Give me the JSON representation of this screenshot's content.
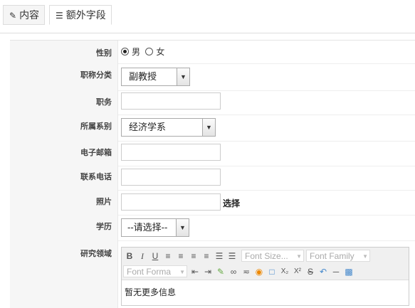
{
  "tabs": [
    {
      "label": "内容",
      "icon": "edit-icon"
    },
    {
      "label": "额外字段",
      "icon": "fields-icon"
    }
  ],
  "fields": {
    "gender": {
      "label": "性别",
      "options": [
        "男",
        "女"
      ],
      "selected": "男"
    },
    "title_category": {
      "label": "职称分类",
      "value": "副教授"
    },
    "position": {
      "label": "职务",
      "value": ""
    },
    "department": {
      "label": "所属系别",
      "value": "经济学系"
    },
    "email": {
      "label": "电子邮箱",
      "value": ""
    },
    "phone": {
      "label": "联系电话",
      "value": ""
    },
    "photo": {
      "label": "照片",
      "value": "",
      "button": "选择"
    },
    "education": {
      "label": "学历",
      "value": "--请选择--"
    },
    "research": {
      "label": "研究领域",
      "content": "暂无更多信息"
    }
  },
  "editor": {
    "font_size": "Font Size...",
    "font_family": "Font Family",
    "font_format": "Font Forma"
  }
}
